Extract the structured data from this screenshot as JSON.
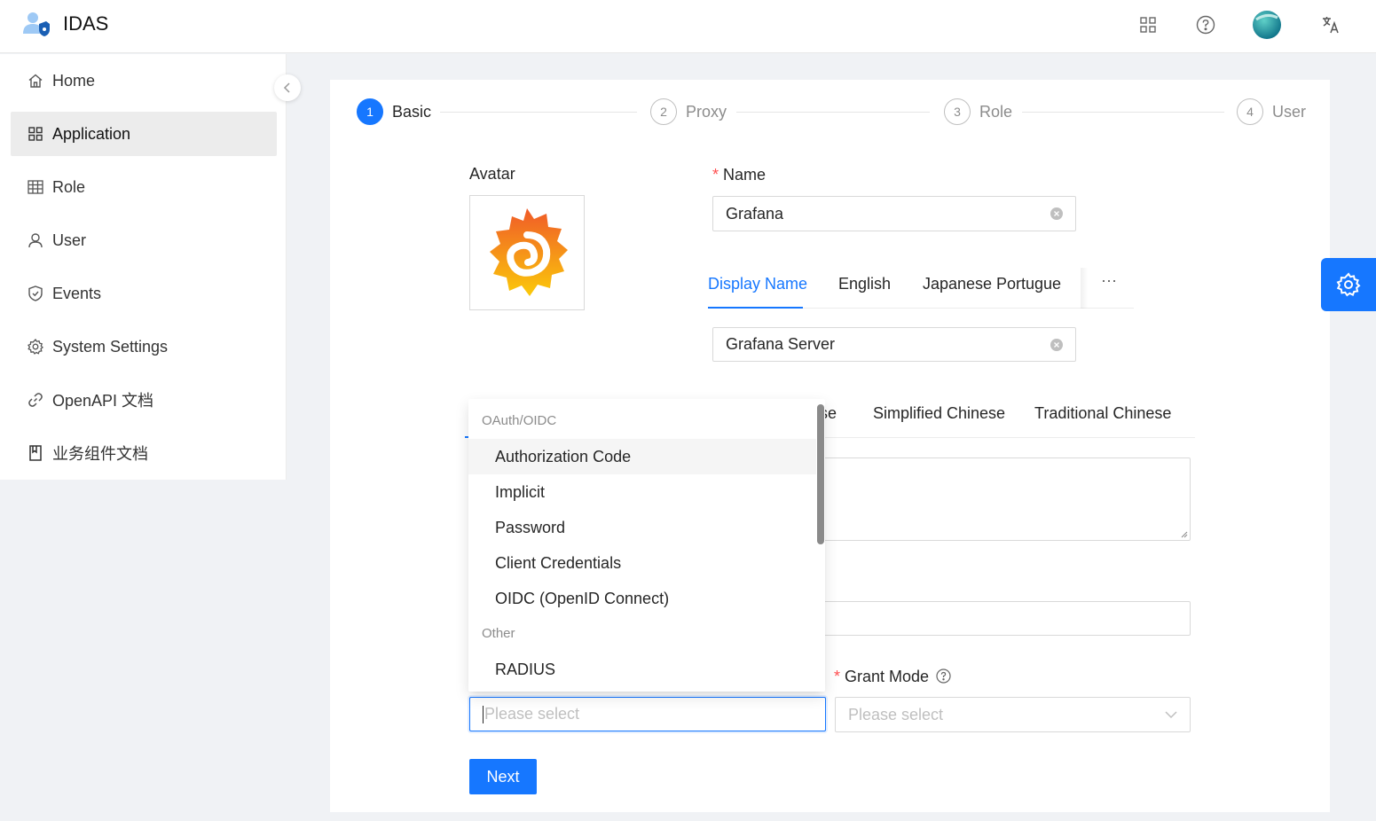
{
  "header": {
    "app_title": "IDAS",
    "icons": [
      "apps-grid-icon",
      "help-icon",
      "avatar",
      "translate-icon"
    ]
  },
  "sidebar": {
    "items": [
      {
        "label": "Home",
        "icon": "home-icon"
      },
      {
        "label": "Application",
        "icon": "grid-icon",
        "active": true
      },
      {
        "label": "Role",
        "icon": "table-icon"
      },
      {
        "label": "User",
        "icon": "user-icon"
      },
      {
        "label": "Events",
        "icon": "shield-icon"
      },
      {
        "label": "System Settings",
        "icon": "gear-icon"
      },
      {
        "label": "OpenAPI 文档",
        "icon": "link-icon"
      },
      {
        "label": "业务组件文档",
        "icon": "book-icon"
      }
    ]
  },
  "steps": [
    {
      "num": "1",
      "label": "Basic",
      "active": true
    },
    {
      "num": "2",
      "label": "Proxy"
    },
    {
      "num": "3",
      "label": "Role"
    },
    {
      "num": "4",
      "label": "User"
    }
  ],
  "form": {
    "avatar_label": "Avatar",
    "name_label": "Name",
    "name_value": "Grafana",
    "display_tabs": [
      "Display Name",
      "English",
      "Japanese",
      "Portugue"
    ],
    "more_label": "···",
    "display_name_value": "Grafana Server",
    "desc_tabs_partial": "se",
    "desc_tabs": [
      "Simplified Chinese",
      "Traditional Chinese"
    ],
    "grant_mode_label": "Grant Mode",
    "grant_type_placeholder": "Please select",
    "grant_mode_placeholder": "Please select",
    "next_label": "Next"
  },
  "dropdown": {
    "group1": "OAuth/OIDC",
    "group1_options": [
      "Authorization Code",
      "Implicit",
      "Password",
      "Client Credentials",
      "OIDC (OpenID Connect)"
    ],
    "group2": "Other",
    "group2_options": [
      "RADIUS"
    ]
  },
  "colors": {
    "primary": "#1677ff",
    "required": "#ff4d4f"
  }
}
